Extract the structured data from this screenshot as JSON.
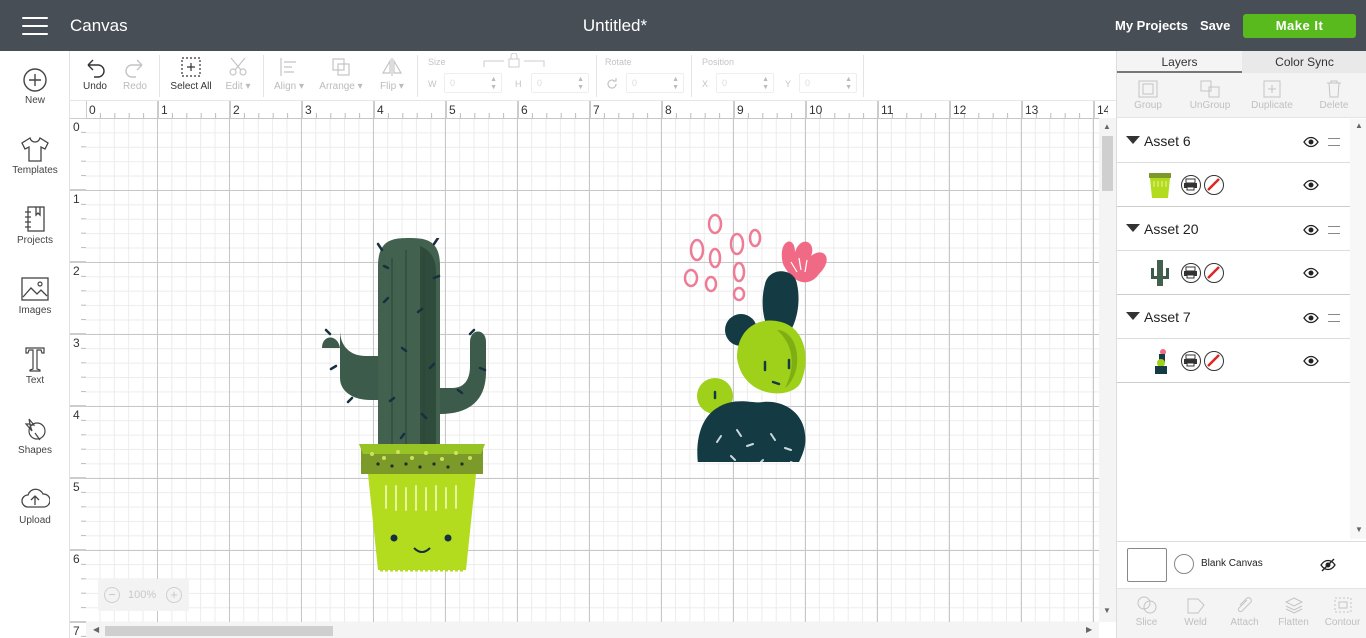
{
  "header": {
    "app_title": "Canvas",
    "doc_title": "Untitled*",
    "my_projects": "My Projects",
    "save": "Save",
    "make_it": "Make It",
    "accent": "#59ba1d",
    "bar_color": "#474e55"
  },
  "left_nav": [
    {
      "label": "New",
      "icon": "plus-circle-icon"
    },
    {
      "label": "Templates",
      "icon": "tshirt-icon"
    },
    {
      "label": "Projects",
      "icon": "notebook-icon"
    },
    {
      "label": "Images",
      "icon": "image-icon"
    },
    {
      "label": "Text",
      "icon": "text-t-icon"
    },
    {
      "label": "Shapes",
      "icon": "shapes-icon"
    },
    {
      "label": "Upload",
      "icon": "cloud-upload-icon"
    }
  ],
  "toolbar": {
    "undo": "Undo",
    "redo": "Redo",
    "select_all": "Select All",
    "edit": "Edit",
    "align": "Align",
    "arrange": "Arrange",
    "flip": "Flip",
    "size": "Size",
    "w": "W",
    "h": "H",
    "w_value": "0",
    "h_value": "0",
    "rotate": "Rotate",
    "rotate_value": "0",
    "position": "Position",
    "x": "X",
    "y": "Y",
    "x_value": "0",
    "y_value": "0"
  },
  "rulers": {
    "horizontal": [
      "0",
      "1",
      "2",
      "3",
      "4",
      "5",
      "6",
      "7",
      "8",
      "9",
      "10",
      "11",
      "12",
      "13",
      "14"
    ],
    "vertical": [
      "0",
      "1",
      "2",
      "3",
      "4",
      "5",
      "6",
      "7"
    ]
  },
  "zoom": {
    "value": "100%",
    "minus": "−",
    "plus": "+"
  },
  "right_panel": {
    "tabs": [
      "Layers",
      "Color Sync"
    ],
    "tools": [
      "Group",
      "UnGroup",
      "Duplicate",
      "Delete"
    ],
    "layers": [
      {
        "name": "Asset 6",
        "thumb": "potted-cactus-thumbnail"
      },
      {
        "name": "Asset 20",
        "thumb": "cactus-thumbnail"
      },
      {
        "name": "Asset 7",
        "thumb": "flowering-cactus-thumbnail"
      }
    ],
    "blank_canvas": "Blank Canvas",
    "bottom_tools": [
      "Slice",
      "Weld",
      "Attach",
      "Flatten",
      "Contour"
    ]
  }
}
